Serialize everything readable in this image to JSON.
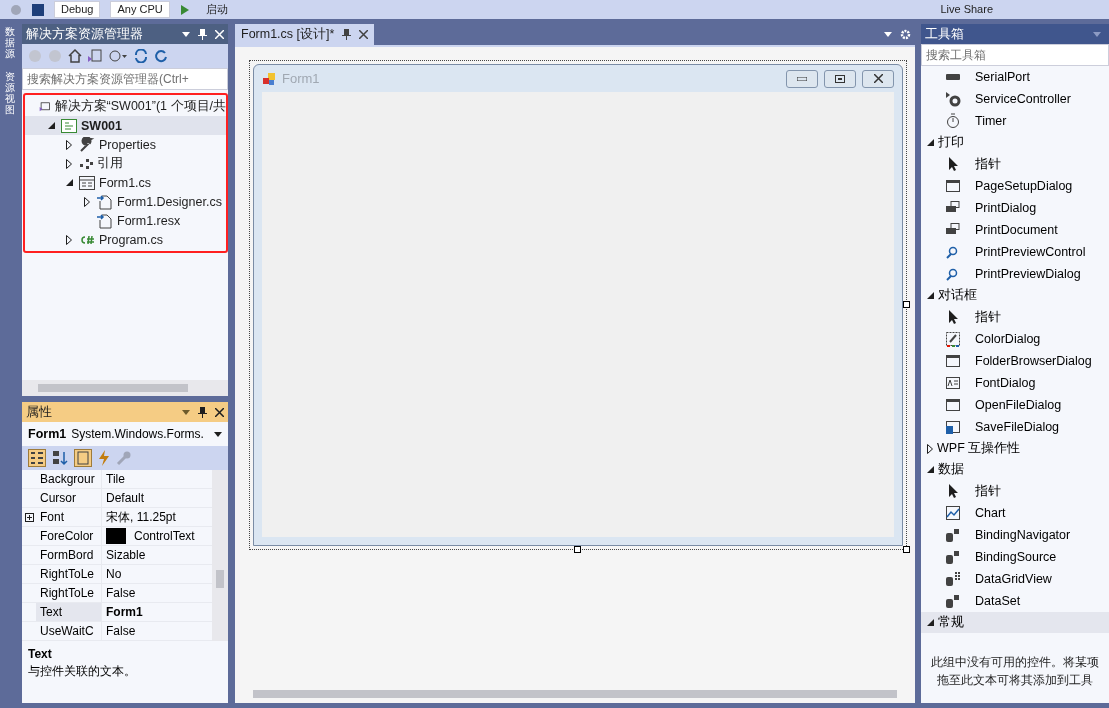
{
  "toolbar": {
    "configuration": "Debug",
    "platform": "Any CPU",
    "start": "启动",
    "live_share": "Live Share"
  },
  "side_tabs": [
    "数据源",
    "资源视图"
  ],
  "solution_explorer": {
    "title": "解决方案资源管理器",
    "search": {
      "placeholder": "搜索解决方案资源管理器(Ctrl+"
    },
    "tree": [
      {
        "label": "解决方案“SW001”(1 个项目/共",
        "kind": "solution",
        "bold": false,
        "selected": false,
        "children": [
          {
            "label": "SW001",
            "kind": "csproject",
            "bold": true,
            "selected": true,
            "expanded": true,
            "children": [
              {
                "label": "Properties",
                "kind": "wrench",
                "bold": false,
                "selected": false,
                "expanded": false
              },
              {
                "label": "引用",
                "kind": "references",
                "bold": false,
                "selected": false,
                "expanded": false
              },
              {
                "label": "Form1.cs",
                "kind": "form",
                "bold": false,
                "selected": false,
                "expanded": true,
                "children": [
                  {
                    "label": "Form1.Designer.cs",
                    "kind": "file",
                    "bold": false,
                    "selected": false,
                    "expanded": false
                  },
                  {
                    "label": "Form1.resx",
                    "kind": "file",
                    "bold": false,
                    "selected": false
                  }
                ]
              },
              {
                "label": "Program.cs",
                "kind": "csharp",
                "bold": false,
                "selected": false,
                "expanded": false
              }
            ]
          }
        ]
      }
    ]
  },
  "properties": {
    "title": "属性",
    "object_name": "Form1",
    "object_type": "System.Windows.Forms.",
    "rows": [
      {
        "name": "Backgrour",
        "value": "Tile",
        "selected": false
      },
      {
        "name": "Cursor",
        "value": "Default",
        "selected": false
      },
      {
        "name": "Font",
        "value": "宋体, 11.25pt",
        "selected": false,
        "expanded": false
      },
      {
        "name": "ForeColor",
        "value": "ControlText",
        "selected": false,
        "color": "#000000"
      },
      {
        "name": "FormBord",
        "value": "Sizable",
        "selected": false
      },
      {
        "name": "RightToLe",
        "value": "No",
        "selected": false
      },
      {
        "name": "RightToLe",
        "value": "False",
        "selected": false
      },
      {
        "name": "Text",
        "value": "Form1",
        "selected": true
      },
      {
        "name": "UseWaitC",
        "value": "False",
        "selected": false
      }
    ],
    "description": {
      "title": "Text",
      "text": "与控件关联的文本。"
    }
  },
  "document": {
    "tab": {
      "label": "Form1.cs [设计]*",
      "selected": true
    },
    "form_title": "Form1"
  },
  "toolbox": {
    "title": "工具箱",
    "search": {
      "placeholder": "搜索工具箱"
    },
    "groups": [
      {
        "items": [
          {
            "label": "SerialPort",
            "kind": "port"
          },
          {
            "label": "ServiceController",
            "kind": "gear"
          },
          {
            "label": "Timer",
            "kind": "timer"
          }
        ]
      },
      {
        "header": "打印",
        "expanded": true,
        "selected": false,
        "items": [
          {
            "label": "指针",
            "kind": "pointer"
          },
          {
            "label": "PageSetupDialog",
            "kind": "window"
          },
          {
            "label": "PrintDialog",
            "kind": "printer"
          },
          {
            "label": "PrintDocument",
            "kind": "printer"
          },
          {
            "label": "PrintPreviewControl",
            "kind": "magnifier"
          },
          {
            "label": "PrintPreviewDialog",
            "kind": "magnifier"
          }
        ]
      },
      {
        "header": "对话框",
        "expanded": true,
        "selected": false,
        "items": [
          {
            "label": "指针",
            "kind": "pointer"
          },
          {
            "label": "ColorDialog",
            "kind": "color"
          },
          {
            "label": "FolderBrowserDialog",
            "kind": "window"
          },
          {
            "label": "FontDialog",
            "kind": "font"
          },
          {
            "label": "OpenFileDialog",
            "kind": "window"
          },
          {
            "label": "SaveFileDialog",
            "kind": "disk"
          }
        ]
      },
      {
        "header": "WPF 互操作性",
        "expanded": false,
        "selected": false
      },
      {
        "header": "数据",
        "expanded": true,
        "selected": false,
        "items": [
          {
            "label": "指针",
            "kind": "pointer"
          },
          {
            "label": "Chart",
            "kind": "chart"
          },
          {
            "label": "BindingNavigator",
            "kind": "database"
          },
          {
            "label": "BindingSource",
            "kind": "database"
          },
          {
            "label": "DataGridView",
            "kind": "grid"
          },
          {
            "label": "DataSet",
            "kind": "database"
          }
        ]
      },
      {
        "header": "常规",
        "expanded": true,
        "selected": true,
        "empty_message": "此组中没有可用的控件。将某项拖至此文本可将其添加到工具"
      }
    ]
  }
}
